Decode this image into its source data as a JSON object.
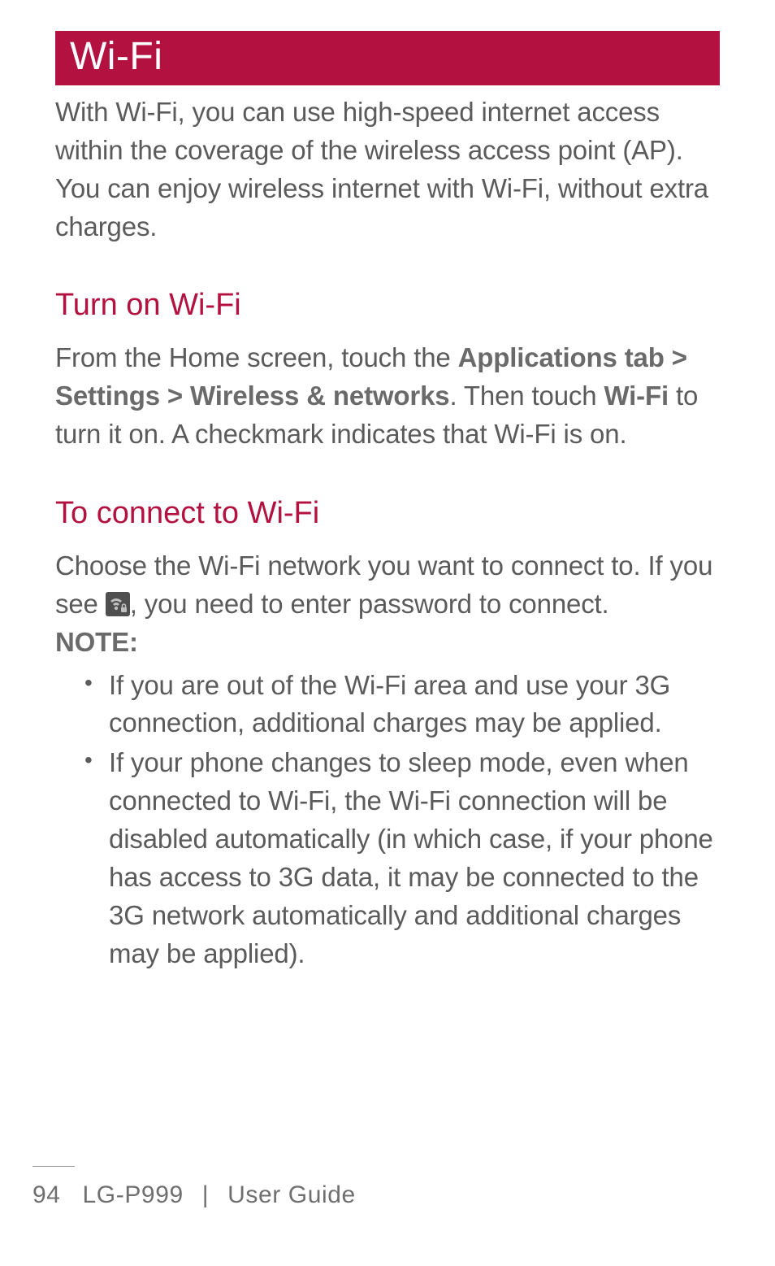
{
  "title_bar": "Wi-Fi",
  "intro": "With Wi-Fi, you can use high-speed internet access within the coverage of the wireless access point (AP). You can enjoy wireless internet with Wi-Fi, without extra charges.",
  "section1": {
    "heading": "Turn on Wi-Fi",
    "para_pre": "From the Home screen, touch the ",
    "bold1": "Applications tab > Settings > Wireless & networks",
    "mid1": ". Then touch ",
    "bold2": "Wi-Fi",
    "para_post": " to turn it on. A checkmark indicates that Wi-Fi is on."
  },
  "section2": {
    "heading": "To connect to Wi-Fi",
    "para_pre": "Choose the Wi-Fi network you want to connect to. If you see ",
    "para_post": ", you need to enter password to connect.",
    "note_label": "NOTE:",
    "notes": [
      "If you are out of the Wi-Fi area and use your 3G connection, additional charges may be applied.",
      "If your phone changes to sleep mode, even when connected to Wi-Fi, the Wi-Fi connection will be disabled automatically (in which case, if your phone has access to 3G data, it may be connected to the 3G network automatically and additional charges may be applied)."
    ]
  },
  "footer": {
    "page_number": "94",
    "model": "LG-P999",
    "divider": "|",
    "guide_label": "User Guide"
  },
  "icons": {
    "wifi_lock": "wifi-lock-icon"
  }
}
